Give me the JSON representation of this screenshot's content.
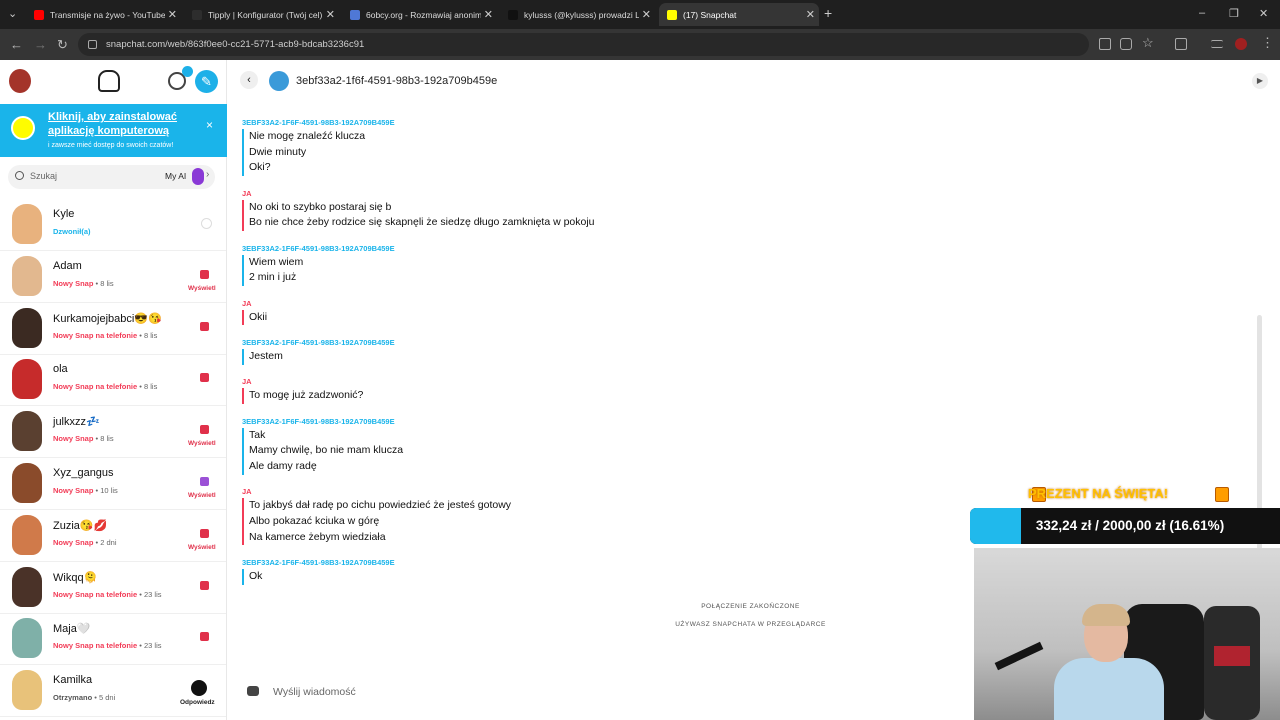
{
  "browser": {
    "tabs": [
      {
        "label": "Transmisje na żywo - YouTube S",
        "fav_color": "#ff0000"
      },
      {
        "label": "Tipply | Konfigurator (Twój cel)",
        "fav_color": "#2d2d2d"
      },
      {
        "label": "6obcy.org - Rozmawiaj anonim",
        "fav_color": "#4f78d6"
      },
      {
        "label": "kylusss (@kylusss) prowadzi LIV",
        "fav_color": "#111111"
      },
      {
        "label": "(17) Snapchat",
        "fav_color": "#fffc00"
      }
    ],
    "active_tab": 4,
    "new_tab": "+",
    "url": "snapchat.com/web/863f0ee0-cc21-5771-acb9-bdcab3236c91"
  },
  "sidebar": {
    "promo": {
      "title": "Kliknij, aby zainstalować aplikację komputerową",
      "subtitle": "i zawsze mieć dostęp do swoich czatów!",
      "close": "×"
    },
    "search": {
      "placeholder": "Szukaj",
      "my_ai": "My AI",
      "chevron": "›"
    },
    "friends": [
      {
        "name": "Kyle",
        "kind": "Dzwonił(a)",
        "time": "",
        "kind_color": "#1ab4ea",
        "badge": "ring",
        "action": "",
        "avatar_color": "#e8b27e"
      },
      {
        "name": "Adam",
        "kind": "Nowy Snap",
        "time": " • 8 lis",
        "kind_color": "#f23c57",
        "badge": "square",
        "badge_color": "#e0304a",
        "action": "Wyświetl",
        "avatar_color": "#e2b88f"
      },
      {
        "name": "Kurkamojejbabci😎😘",
        "kind": "Nowy Snap na telefonie",
        "time": " • 8 lis",
        "kind_color": "#f23c57",
        "badge": "square",
        "badge_color": "#e0304a",
        "action": "",
        "avatar_color": "#3b2a22"
      },
      {
        "name": "ola",
        "kind": "Nowy Snap na telefonie",
        "time": " • 8 lis",
        "kind_color": "#f23c57",
        "badge": "square",
        "badge_color": "#e0304a",
        "action": "",
        "avatar_color": "#c62b2b"
      },
      {
        "name": "julkxzz💤",
        "kind": "Nowy Snap",
        "time": " • 8 lis",
        "kind_color": "#f23c57",
        "badge": "square",
        "badge_color": "#e0304a",
        "action": "Wyświetl",
        "avatar_color": "#5a4030"
      },
      {
        "name": "Xyz_gangus",
        "kind": "Nowy Snap",
        "time": " • 10 lis",
        "kind_color": "#f23c57",
        "badge": "square",
        "badge_color": "#9b51d6",
        "action": "Wyświetl",
        "avatar_color": "#8a4b2b"
      },
      {
        "name": "Zuzia😘💋",
        "kind": "Nowy Snap",
        "time": " • 2 dni",
        "kind_color": "#f23c57",
        "badge": "square",
        "badge_color": "#e0304a",
        "action": "Wyświetl",
        "avatar_color": "#d07a4a"
      },
      {
        "name": "Wikqq🫠",
        "kind": "Nowy Snap na telefonie",
        "time": " • 23 lis",
        "kind_color": "#f23c57",
        "badge": "square",
        "badge_color": "#e0304a",
        "action": "",
        "avatar_color": "#4a3228"
      },
      {
        "name": "Maja🤍",
        "kind": "Nowy Snap na telefonie",
        "time": " • 23 lis",
        "kind_color": "#f23c57",
        "badge": "square",
        "badge_color": "#e0304a",
        "action": "",
        "avatar_color": "#7fb0a8"
      },
      {
        "name": "Kamilka",
        "kind": "Otrzymano",
        "time": " • 5 dni",
        "kind_color": "#555555",
        "badge": "camera",
        "action": "Odpowiedz",
        "avatar_color": "#e8c27a"
      }
    ]
  },
  "chat": {
    "title": "3ebf33a2-1f6f-4591-98b3-192a709b459e",
    "back": "‹",
    "more": "▶",
    "messages": [
      {
        "from": "them",
        "sender": "3EBF33A2-1F6F-4591-98B3-192A709B459E",
        "lines": [
          "Nie mogę znaleźć klucza",
          "Dwie minuty",
          "Oki?"
        ]
      },
      {
        "from": "me",
        "sender": "JA",
        "lines": [
          "No oki to szybko postaraj się b",
          "Bo nie chce żeby rodzice się skapnęli że siedzę długo zamknięta w pokoju"
        ]
      },
      {
        "from": "them",
        "sender": "3EBF33A2-1F6F-4591-98B3-192A709B459E",
        "lines": [
          "Wiem wiem",
          "2 min i już"
        ]
      },
      {
        "from": "me",
        "sender": "JA",
        "lines": [
          "Okii"
        ]
      },
      {
        "from": "them",
        "sender": "3EBF33A2-1F6F-4591-98B3-192A709B459E",
        "lines": [
          "Jestem"
        ]
      },
      {
        "from": "me",
        "sender": "JA",
        "lines": [
          "To mogę już zadzwonić?"
        ]
      },
      {
        "from": "them",
        "sender": "3EBF33A2-1F6F-4591-98B3-192A709B459E",
        "lines": [
          "Tak",
          "Mamy chwilę, bo nie mam klucza",
          "Ale damy radę"
        ]
      },
      {
        "from": "me",
        "sender": "JA",
        "lines": [
          "To jakbyś dał radę po cichu powiedzieć że jesteś gotowy",
          "Albo pokazać kciuka w górę",
          "Na kamerce żebym wiedziała"
        ]
      },
      {
        "from": "them",
        "sender": "3EBF33A2-1F6F-4591-98B3-192A709B459E",
        "lines": [
          "Ok"
        ]
      }
    ],
    "system": [
      "POŁĄCZENIE ZAKOŃCZONE",
      "UŻYWASZ SNAPCHATA W PRZEGLĄDARCE"
    ],
    "compose_placeholder": "Wyślij wiadomość"
  },
  "overlay": {
    "title": "PREZENT NA ŚWIĘTA!",
    "progress_text": "332,24 zł / 2000,00 zł (16.61%)",
    "progress_fraction": 0.1661
  }
}
